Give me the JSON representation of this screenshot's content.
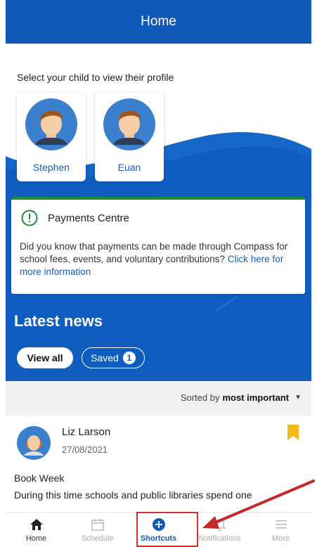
{
  "header": {
    "title": "Home"
  },
  "children_section": {
    "prompt": "Select your child to view their profile",
    "children": [
      {
        "name": "Stephen"
      },
      {
        "name": "Euan"
      }
    ]
  },
  "payments": {
    "title": "Payments Centre",
    "body": "Did you know that payments can be made through Compass for school fees, events, and voluntary contributions?",
    "link": "Click here for more information"
  },
  "news": {
    "title": "Latest news",
    "view_all": "View all",
    "saved_label": "Saved",
    "saved_count": "1",
    "sort_prefix": "Sorted by",
    "sort_value": "most important"
  },
  "post": {
    "author": "Liz Larson",
    "date": "27/08/2021",
    "title": "Book Week",
    "body": "During this time schools and public libraries spend one"
  },
  "bottom_nav": {
    "items": [
      {
        "label": "Home",
        "icon": "home-icon"
      },
      {
        "label": "Schedule",
        "icon": "calendar-icon"
      },
      {
        "label": "Shortcuts",
        "icon": "plus-circle-icon"
      },
      {
        "label": "Notifications",
        "icon": "bell-icon"
      },
      {
        "label": "More",
        "icon": "menu-icon"
      }
    ]
  },
  "colors": {
    "primary": "#1159b8",
    "success_border": "#1c8c3c",
    "bookmark": "#f6b818",
    "annotation": "#d32f2f"
  }
}
